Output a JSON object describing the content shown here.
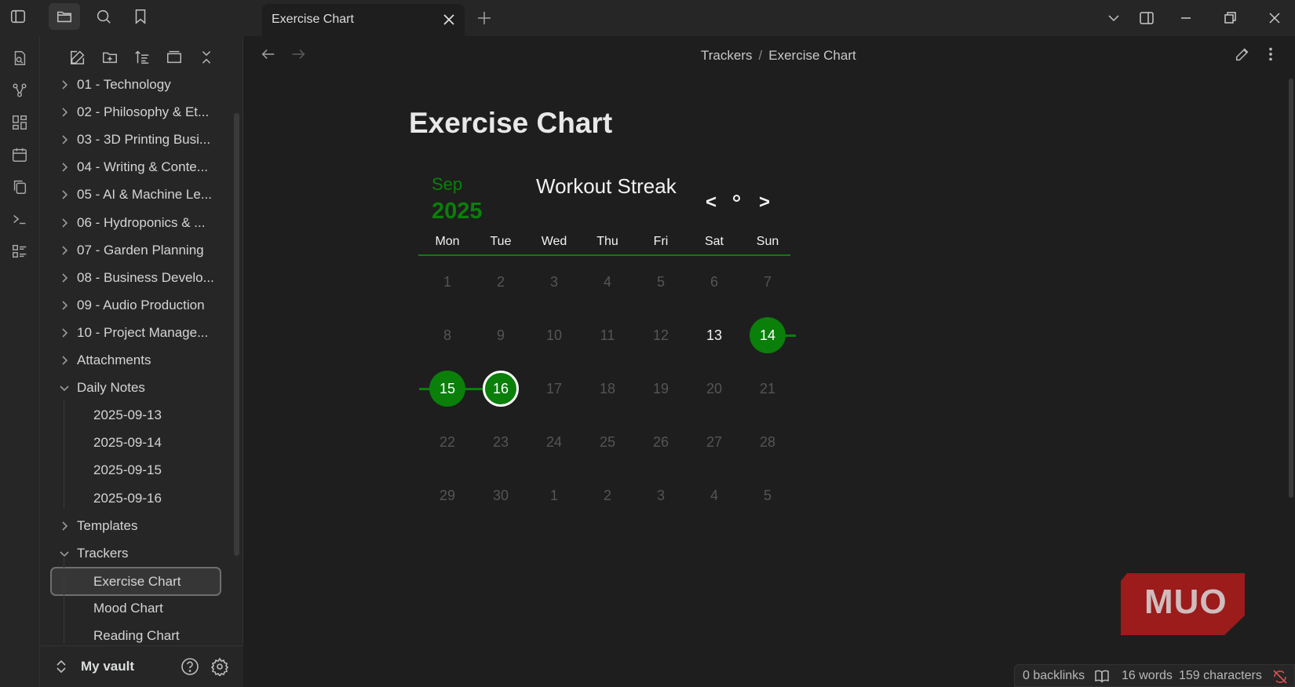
{
  "window": {
    "tab_title": "Exercise Chart"
  },
  "topbar_icons": [
    "sidebar-toggle-icon",
    "folder-icon",
    "search-icon",
    "bookmark-icon"
  ],
  "sidebar": {
    "folders": [
      {
        "label": "01 - Technology",
        "expanded": false
      },
      {
        "label": "02 - Philosophy & Et...",
        "expanded": false
      },
      {
        "label": "03 - 3D Printing Busi...",
        "expanded": false
      },
      {
        "label": "04 - Writing & Conte...",
        "expanded": false
      },
      {
        "label": "05 - AI & Machine Le...",
        "expanded": false
      },
      {
        "label": "06 - Hydroponics & ...",
        "expanded": false
      },
      {
        "label": "07 - Garden Planning",
        "expanded": false
      },
      {
        "label": "08 - Business Develo...",
        "expanded": false
      },
      {
        "label": "09 - Audio Production",
        "expanded": false
      },
      {
        "label": "10 - Project Manage...",
        "expanded": false
      },
      {
        "label": "Attachments",
        "expanded": false
      },
      {
        "label": "Daily Notes",
        "expanded": true
      }
    ],
    "daily_notes": [
      "2025-09-13",
      "2025-09-14",
      "2025-09-15",
      "2025-09-16"
    ],
    "templates_label": "Templates",
    "trackers_label": "Trackers",
    "trackers": [
      "Exercise Chart",
      "Mood Chart",
      "Reading Chart"
    ],
    "selected_file": "Exercise Chart",
    "vault_name": "My vault"
  },
  "main": {
    "breadcrumb": {
      "folder": "Trackers",
      "separator": "/",
      "file": "Exercise Chart"
    },
    "title": "Exercise Chart"
  },
  "calendar": {
    "month": "Sep",
    "year": "2025",
    "title": "Workout Streak",
    "prev": "<",
    "next": ">",
    "weekdays": [
      "Mon",
      "Tue",
      "Wed",
      "Thu",
      "Fri",
      "Sat",
      "Sun"
    ],
    "weeks": [
      [
        "1",
        "2",
        "3",
        "4",
        "5",
        "6",
        "7"
      ],
      [
        "8",
        "9",
        "10",
        "11",
        "12",
        "13",
        "14"
      ],
      [
        "15",
        "16",
        "17",
        "18",
        "19",
        "20",
        "21"
      ],
      [
        "22",
        "23",
        "24",
        "25",
        "26",
        "27",
        "28"
      ],
      [
        "29",
        "30",
        "1",
        "2",
        "3",
        "4",
        "5"
      ]
    ],
    "completed_days": [
      "14",
      "15",
      "16"
    ],
    "current_day": "16",
    "highlight_day": "13",
    "accent_color": "#0a7f0a"
  },
  "status": {
    "backlinks": "0 backlinks",
    "words": "16 words",
    "characters": "159 characters"
  },
  "watermark": "MUO"
}
